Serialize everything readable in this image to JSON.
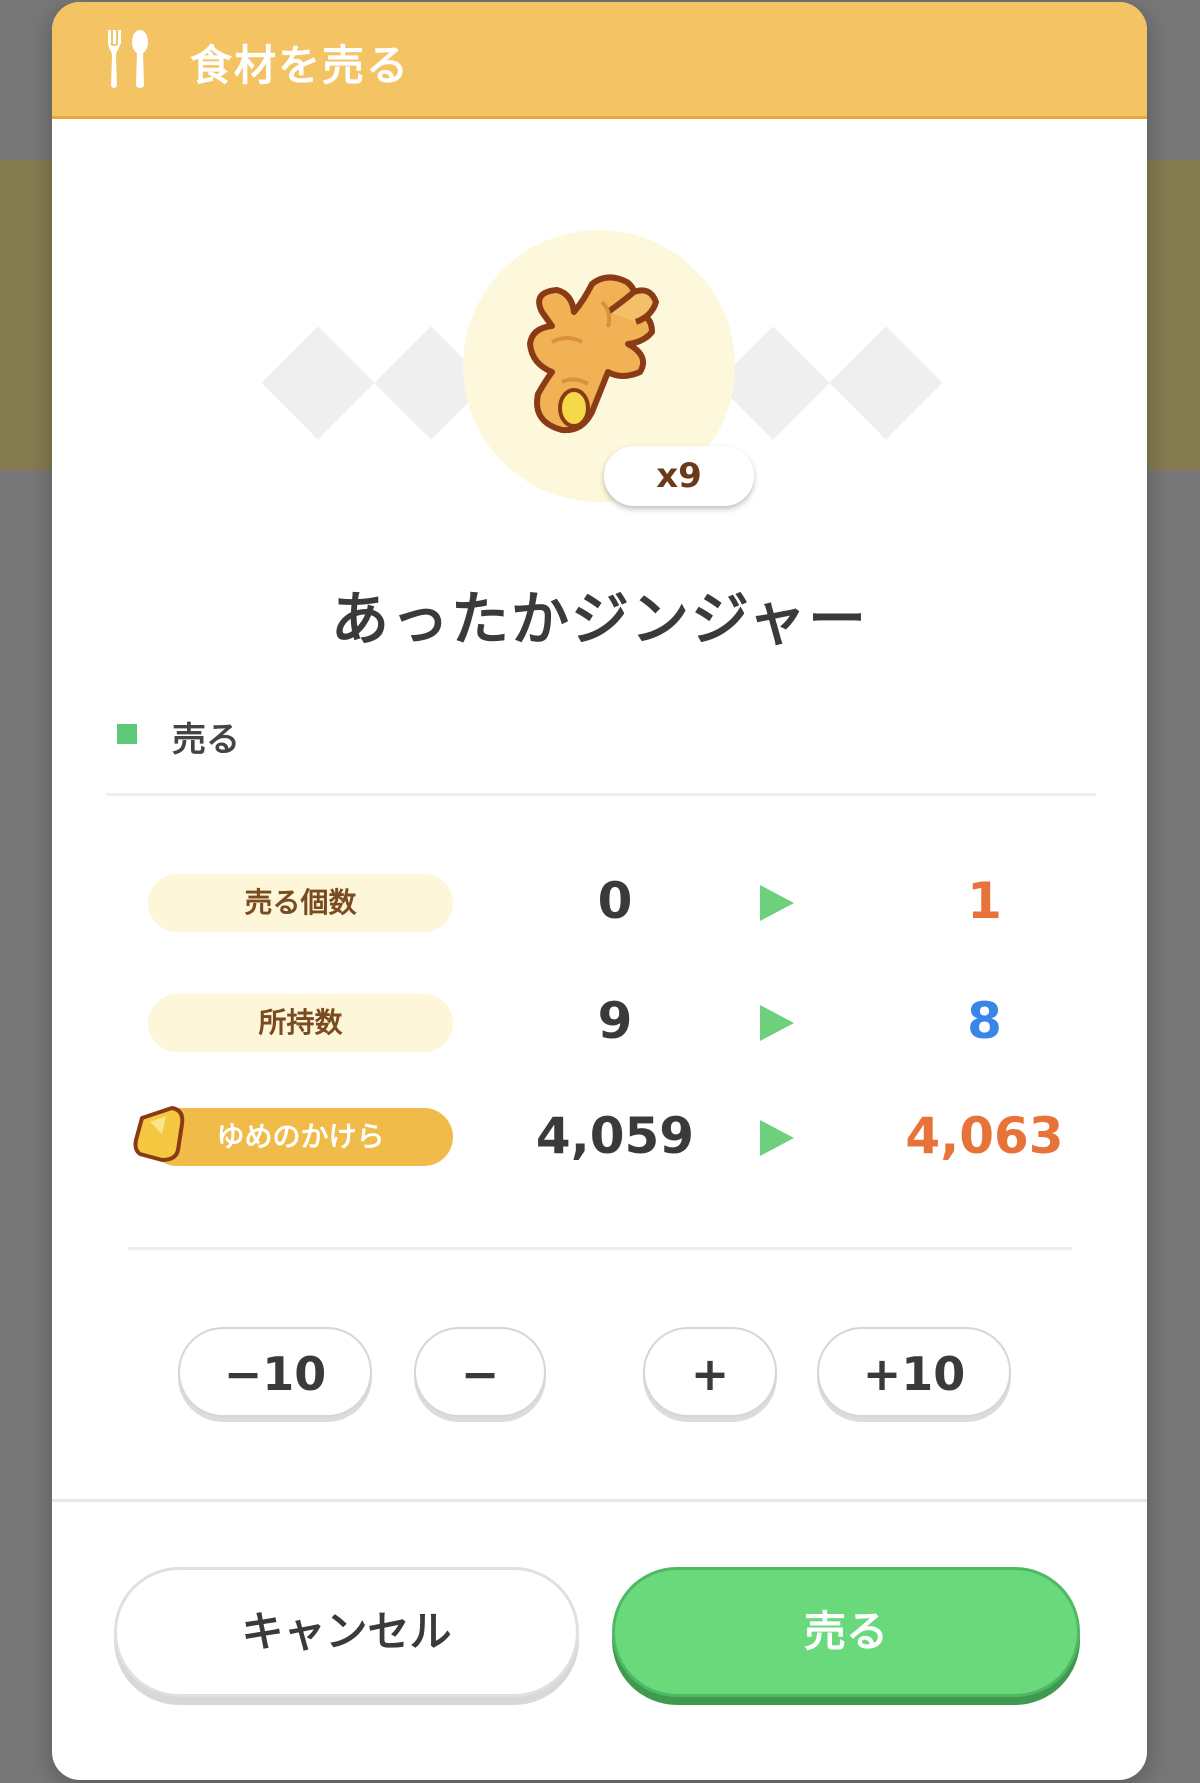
{
  "header": {
    "title": "食材を売る",
    "icon": "fork-spoon-icon"
  },
  "item": {
    "name": "あったかジンジャー",
    "owned_badge": "x9",
    "icon": "ginger-icon"
  },
  "section": {
    "label": "売る"
  },
  "rows": [
    {
      "label": "売る個数",
      "from": "0",
      "to": "1",
      "to_color": "#e8733a"
    },
    {
      "label": "所持数",
      "from": "9",
      "to": "8",
      "to_color": "#3a86e8"
    },
    {
      "label": "ゆめのかけら",
      "from": "4,059",
      "to": "4,063",
      "to_color": "#e8733a",
      "icon": "dream-shard-icon"
    }
  ],
  "steppers": {
    "minus_ten": "−10",
    "minus": "−",
    "plus": "+",
    "plus_ten": "+10"
  },
  "footer": {
    "cancel_label": "キャンセル",
    "sell_label": "売る"
  },
  "colors": {
    "header": "#f4c464",
    "accent_green": "#6ad97c",
    "increase": "#e8733a",
    "decrease": "#3a86e8"
  }
}
